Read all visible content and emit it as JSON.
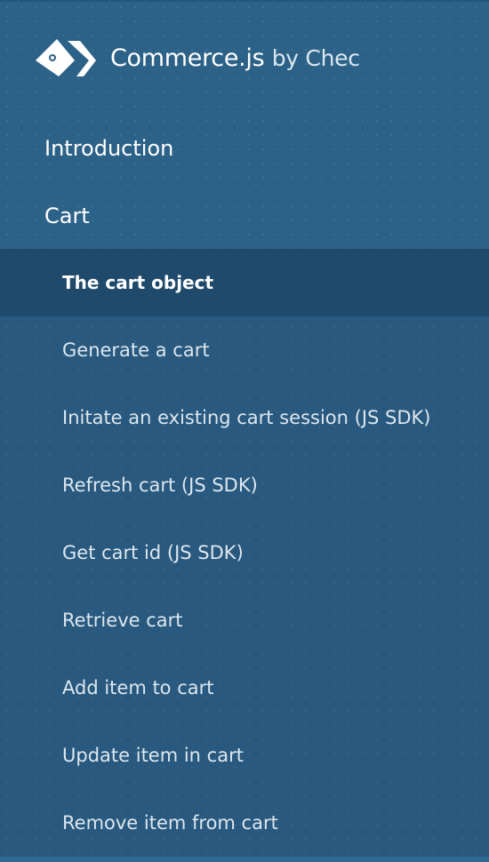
{
  "brand": {
    "name": "Commerce.js",
    "suffix": "by Chec",
    "logo_icon": "chec-logo-icon"
  },
  "nav": {
    "top_items": [
      {
        "label": "Introduction"
      },
      {
        "label": "Cart"
      }
    ],
    "sub_items": [
      {
        "label": "The cart object",
        "active": true
      },
      {
        "label": "Generate a cart"
      },
      {
        "label": "Initate an existing cart session (JS SDK)"
      },
      {
        "label": "Refresh cart (JS SDK)"
      },
      {
        "label": "Get cart id (JS SDK)"
      },
      {
        "label": "Retrieve cart"
      },
      {
        "label": "Add item to cart"
      },
      {
        "label": "Update item in cart"
      },
      {
        "label": "Remove item from cart"
      }
    ]
  },
  "colors": {
    "background": "#2c6288",
    "active_background": "#1f4a6b",
    "text": "#ffffff"
  }
}
